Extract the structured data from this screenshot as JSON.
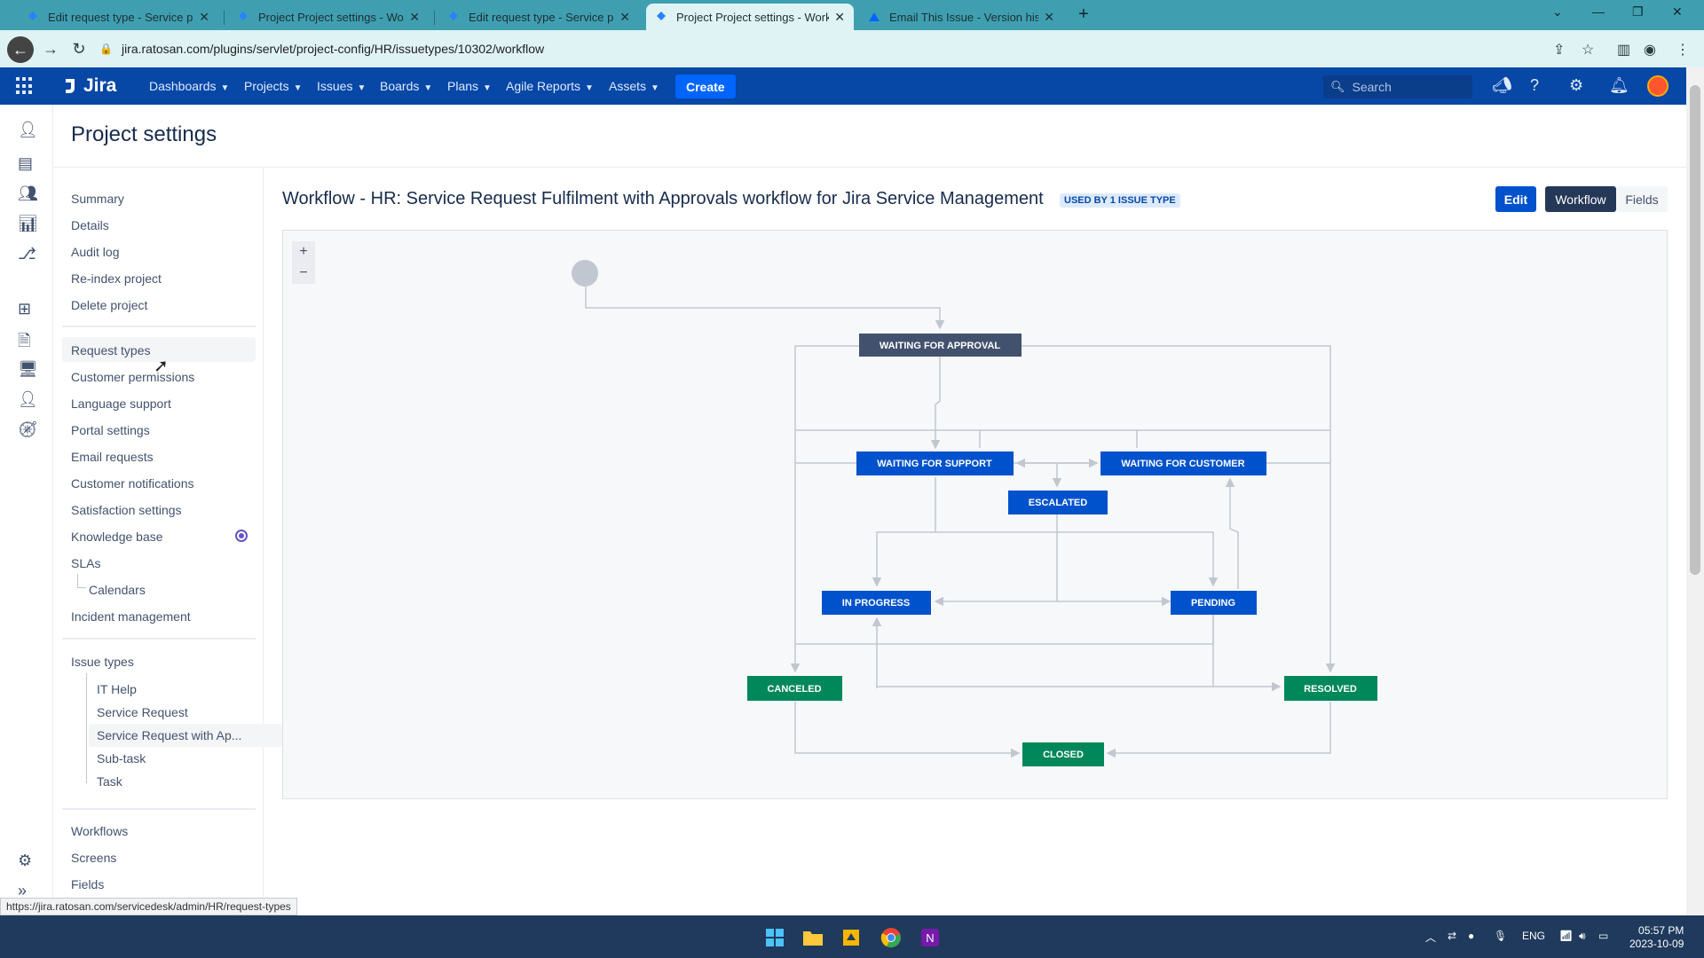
{
  "browser": {
    "tabs": [
      {
        "title": "Edit request type - Service proje"
      },
      {
        "title": "Project Project settings - Workfl"
      },
      {
        "title": "Edit request type - Service proje"
      },
      {
        "title": "Project Project settings - Workfl",
        "active": true
      },
      {
        "title": "Email This Issue - Version histor"
      }
    ],
    "url": "jira.ratosan.com/plugins/servlet/project-config/HR/issuetypes/10302/workflow",
    "status_link": "https://jira.ratosan.com/servicedesk/admin/HR/request-types"
  },
  "jira_nav": {
    "logo": "Jira",
    "items": [
      "Dashboards",
      "Projects",
      "Issues",
      "Boards",
      "Plans",
      "Agile Reports",
      "Assets"
    ],
    "create_label": "Create",
    "search_placeholder": "Search"
  },
  "page": {
    "title": "Project settings"
  },
  "sidebar": {
    "group1": [
      "Summary",
      "Details",
      "Audit log",
      "Re-index project",
      "Delete project"
    ],
    "group2": [
      "Request types",
      "Customer permissions",
      "Language support",
      "Portal settings",
      "Email requests",
      "Customer notifications",
      "Satisfaction settings",
      "Knowledge base",
      "SLAs",
      "Calendars",
      "Incident management"
    ],
    "issue_types_header": "Issue types",
    "issue_types": [
      "IT Help",
      "Service Request",
      "Service Request with Ap...",
      "Sub-task",
      "Task"
    ],
    "group4": [
      "Workflows",
      "Screens",
      "Fields"
    ]
  },
  "workflow": {
    "title": "Workflow - HR: Service Request Fulfilment with Approvals workflow for Jira Service Management",
    "used_by": "USED BY 1 ISSUE TYPE",
    "edit_label": "Edit",
    "workflow_label": "Workflow",
    "fields_label": "Fields",
    "zoom_in": "+",
    "zoom_out": "−",
    "statuses": {
      "waiting_for_approval": "WAITING FOR APPROVAL",
      "waiting_for_support": "WAITING FOR SUPPORT",
      "waiting_for_customer": "WAITING FOR CUSTOMER",
      "escalated": "ESCALATED",
      "in_progress": "IN PROGRESS",
      "pending": "PENDING",
      "canceled": "CANCELED",
      "resolved": "RESOLVED",
      "closed": "CLOSED"
    }
  },
  "taskbar": {
    "lang": "ENG",
    "time": "05:57 PM",
    "date": "2023-10-09"
  },
  "colors": {
    "jira_blue": "#0747a6",
    "status_blue": "#0052cc",
    "status_dark": "#42526e",
    "status_green": "#00875a",
    "tab_bar": "#3f9fb1"
  }
}
